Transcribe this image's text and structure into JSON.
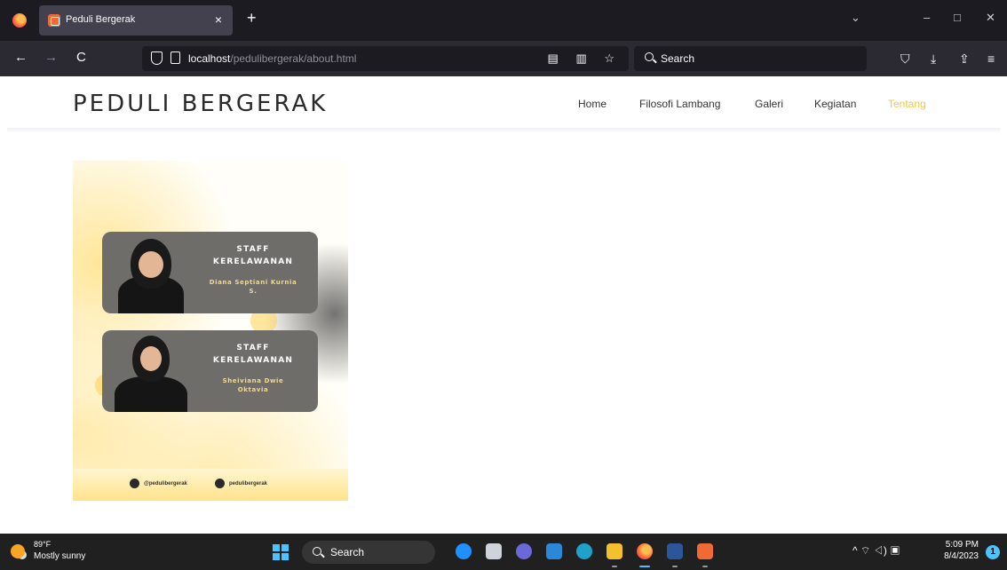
{
  "browser": {
    "tab_title": "Peduli Bergerak",
    "tab_close": "×",
    "new_tab": "+",
    "url_host": "localhost",
    "url_path": "/pedulibergerak/about.html",
    "search_placeholder": "Search",
    "window_controls": [
      "⌄",
      "–",
      "□",
      "✕"
    ],
    "nav_buttons": [
      "←",
      "→",
      "C"
    ],
    "url_icons": "▤ ▥ ☆",
    "right_icons": [
      "⛉",
      "⤓",
      "⇪",
      "≡"
    ]
  },
  "site": {
    "brand": "PEDULI BERGERAK",
    "menu": [
      "Home",
      "Filosofi Lambang",
      "Galeri",
      "Kegiatan",
      "Tentang"
    ],
    "active_menu": "Tentang",
    "accent_color": "#f3c54a"
  },
  "poster": {
    "cards": [
      {
        "title_line1": "STAFF",
        "title_line2": "KERELAWANAN",
        "name_line1": "Diana Septiani Kurnia",
        "name_line2": "S."
      },
      {
        "title_line1": "STAFF",
        "title_line2": "KERELAWANAN",
        "name_line1": "Sheiviana Dwie",
        "name_line2": "Oktavia"
      }
    ],
    "social": [
      "@pedulibergerak",
      "pedulibergerak"
    ]
  },
  "taskbar": {
    "weather_temp": "89°F",
    "weather_cond": "Mostly sunny",
    "search_label": "Search",
    "tray_icons": "^  ⌔  ◁)  ▣",
    "time": "5:09 PM",
    "date": "8/4/2023",
    "notifications": "1"
  }
}
